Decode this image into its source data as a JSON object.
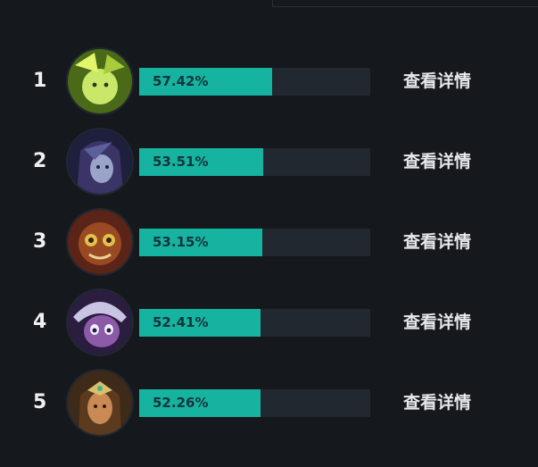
{
  "rankings": [
    {
      "rank": "1",
      "rate_text": "57.42%",
      "rate": 57.42,
      "link": "查看详情",
      "avatar_icon": "champion-portrait-green-icon"
    },
    {
      "rank": "2",
      "rate_text": "53.51%",
      "rate": 53.51,
      "link": "查看详情",
      "avatar_icon": "champion-portrait-purple-icon"
    },
    {
      "rank": "3",
      "rate_text": "53.15%",
      "rate": 53.15,
      "link": "查看详情",
      "avatar_icon": "champion-portrait-bronze-icon"
    },
    {
      "rank": "4",
      "rate_text": "52.41%",
      "rate": 52.41,
      "link": "查看详情",
      "avatar_icon": "champion-portrait-violet-icon"
    },
    {
      "rank": "5",
      "rate_text": "52.26%",
      "rate": 52.26,
      "link": "查看详情",
      "avatar_icon": "champion-portrait-gold-icon"
    }
  ],
  "colors": {
    "background": "#15181d",
    "bar_fill": "#16b3a1",
    "bar_track": "#222830",
    "text": "#e6e8ea"
  }
}
